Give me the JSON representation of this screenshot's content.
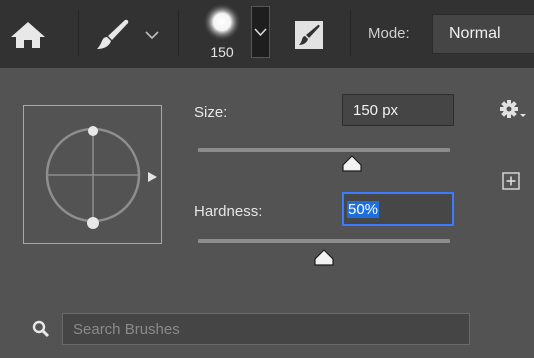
{
  "toolbar": {
    "home_icon": "home-icon",
    "brush_tool_icon": "brush-icon",
    "brush_size": "150",
    "toggle_panel_icon": "brush-settings-panel-icon",
    "mode_label": "Mode:",
    "mode_value": "Normal"
  },
  "panel": {
    "size_label": "Size:",
    "size_value": "150 px",
    "size_slider_fraction": 0.61,
    "hardness_label": "Hardness:",
    "hardness_value": "50%",
    "hardness_slider_fraction": 0.5,
    "gear_icon": "gear-icon",
    "new_preset_icon": "plus-square-icon",
    "search_icon": "search-icon",
    "search_placeholder": "Search Brushes"
  },
  "colors": {
    "toolbar_bg": "#323232",
    "panel_bg": "#535353",
    "accent": "#3b7cff"
  }
}
